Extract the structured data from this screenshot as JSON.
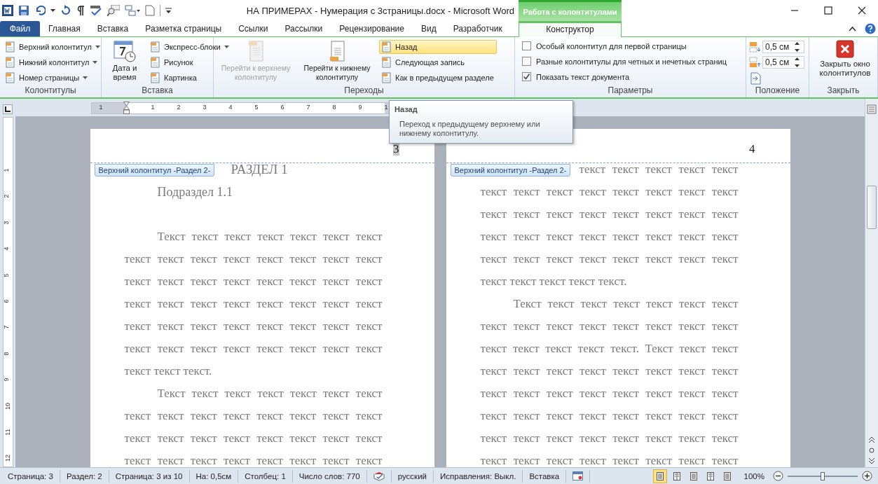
{
  "title_bar": {
    "title": "НА ПРИМЕРАХ - Нумерация с 3страницы.docx  -  Microsoft Word",
    "context_group": "Работа с колонтитулами"
  },
  "tabs": [
    {
      "label": "Файл",
      "kind": "file",
      "selected": false
    },
    {
      "label": "Главная",
      "kind": "tab",
      "selected": false
    },
    {
      "label": "Вставка",
      "kind": "tab",
      "selected": false
    },
    {
      "label": "Разметка страницы",
      "kind": "tab",
      "selected": false
    },
    {
      "label": "Ссылки",
      "kind": "tab",
      "selected": false
    },
    {
      "label": "Рассылки",
      "kind": "tab",
      "selected": false
    },
    {
      "label": "Рецензирование",
      "kind": "tab",
      "selected": false
    },
    {
      "label": "Вид",
      "kind": "tab",
      "selected": false
    },
    {
      "label": "Разработчик",
      "kind": "tab",
      "selected": false
    },
    {
      "label": "Конструктор",
      "kind": "context",
      "selected": true
    }
  ],
  "ribbon": {
    "groups": [
      {
        "label": "Колонтитулы",
        "items": [
          {
            "kind": "small",
            "label": "Верхний колонтитул",
            "dropdown": true,
            "highlighted": false
          },
          {
            "kind": "small",
            "label": "Нижний колонтитул",
            "dropdown": true,
            "highlighted": false
          },
          {
            "kind": "small",
            "label": "Номер страницы",
            "dropdown": true,
            "highlighted": false
          }
        ]
      },
      {
        "label": "Вставка",
        "items": [
          {
            "kind": "large",
            "label": "Дата и время",
            "disabled": false
          },
          {
            "kind": "small",
            "label": "Экспресс-блоки",
            "dropdown": true,
            "highlighted": false
          },
          {
            "kind": "small",
            "label": "Рисунок",
            "dropdown": false,
            "highlighted": false
          },
          {
            "kind": "small",
            "label": "Картинка",
            "dropdown": false,
            "highlighted": false
          }
        ]
      },
      {
        "label": "Переходы",
        "items": [
          {
            "kind": "large",
            "label": "Перейти к верхнему колонтитулу",
            "disabled": true
          },
          {
            "kind": "large",
            "label": "Перейти к нижнему колонтитулу",
            "disabled": false
          },
          {
            "kind": "small",
            "label": "Назад",
            "dropdown": false,
            "highlighted": true
          },
          {
            "kind": "small",
            "label": "Следующая запись",
            "dropdown": false,
            "highlighted": false
          },
          {
            "kind": "small",
            "label": "Как в предыдущем разделе",
            "dropdown": false,
            "highlighted": false
          }
        ]
      },
      {
        "label": "Параметры",
        "items": [
          {
            "kind": "checkbox",
            "label": "Особый колонтитул для первой страницы",
            "checked": false
          },
          {
            "kind": "checkbox",
            "label": "Разные колонтитулы для четных и нечетных страниц",
            "checked": false
          },
          {
            "kind": "checkbox",
            "label": "Показать текст документа",
            "checked": true
          }
        ]
      },
      {
        "label": "Положение",
        "items": [
          {
            "kind": "spinner",
            "value": "0,5 см"
          },
          {
            "kind": "spinner",
            "value": "0,5 см"
          },
          {
            "kind": "icon"
          }
        ]
      },
      {
        "label": "Закрыть",
        "items": [
          {
            "kind": "large",
            "label": "Закрыть окно колонтитулов",
            "disabled": false
          }
        ]
      }
    ]
  },
  "ruler": {
    "numbers": [
      "1",
      "1",
      "2",
      "3",
      "4",
      "5",
      "6",
      "7",
      "8",
      "9",
      "1"
    ],
    "vertical_numbers": [
      "1",
      "2",
      "3",
      "4",
      "5",
      "6",
      "7",
      "8",
      "9",
      "10",
      "11",
      "12"
    ]
  },
  "tooltip": {
    "title": "Назад",
    "text": "Переход к предыдущему верхнему или нижнему колонтитулу."
  },
  "pages": [
    {
      "number": "3",
      "number_selected": true,
      "header_label": "Верхний колонтитул -Раздел 2-",
      "lines": [
        {
          "kind": "heading",
          "text": "РАЗДЕЛ 1"
        },
        {
          "kind": "subheading",
          "text": "Подраздел 1.1"
        },
        {
          "kind": "first",
          "text": "Текст текст текст текст текст текст текст"
        },
        {
          "kind": "full",
          "text": "текст текст текст текст текст текст текст текст"
        },
        {
          "kind": "full",
          "text": "текст текст текст текст текст текст текст текст"
        },
        {
          "kind": "full",
          "text": "текст текст текст текст текст текст текст текст"
        },
        {
          "kind": "full",
          "text": "текст текст текст текст текст текст текст текст"
        },
        {
          "kind": "full",
          "text": "текст текст текст текст текст текст текст текст"
        },
        {
          "kind": "last",
          "text": "текст текст текст."
        },
        {
          "kind": "first",
          "text": "Текст текст текст текст текст текст текст"
        },
        {
          "kind": "full",
          "text": "текст текст текст текст текст текст текст текст"
        },
        {
          "kind": "full",
          "text": "текст текст текст текст текст текст текст текст"
        },
        {
          "kind": "full",
          "text": "текст текст текст текст текст текст текст текст"
        }
      ]
    },
    {
      "number": "4",
      "number_selected": false,
      "header_label": "Верхний колонтитул -Раздел 2-",
      "lines": [
        {
          "kind": "continued",
          "text": "текст текст текст текст текст"
        },
        {
          "kind": "full",
          "text": "текст текст текст текст текст текст текст текст"
        },
        {
          "kind": "full",
          "text": "текст текст текст текст текст текст текст текст"
        },
        {
          "kind": "full",
          "text": "текст текст текст текст текст текст текст текст"
        },
        {
          "kind": "full",
          "text": "текст текст текст текст текст текст текст текст"
        },
        {
          "kind": "last",
          "text": "текст текст текст текст текст."
        },
        {
          "kind": "first",
          "text": "Текст текст текст текст текст текст текст"
        },
        {
          "kind": "full",
          "text": "текст текст текст текст текст текст текст текст"
        },
        {
          "kind": "full",
          "text": "текст текст текст текст текст. Текст текст текст"
        },
        {
          "kind": "full",
          "text": "текст текст текст текст текст текст текст текст"
        },
        {
          "kind": "full",
          "text": "текст текст текст текст текст текст текст текст"
        },
        {
          "kind": "full",
          "text": "текст текст текст текст текст текст текст текст"
        },
        {
          "kind": "full",
          "text": "текст текст текст текст текст текст текст текст"
        },
        {
          "kind": "full",
          "text": "текст текст текст текст текст текст текст текст"
        }
      ]
    }
  ],
  "status_bar": {
    "items": [
      {
        "kind": "text",
        "text": "Страница: 3"
      },
      {
        "kind": "text",
        "text": "Раздел: 2"
      },
      {
        "kind": "text",
        "text": "Страница: 3 из 10"
      },
      {
        "kind": "text",
        "text": "На: 0,5см"
      },
      {
        "kind": "text",
        "text": "Столбец: 1"
      },
      {
        "kind": "text",
        "text": "Число слов: 770"
      },
      {
        "kind": "proofing"
      },
      {
        "kind": "text",
        "text": "русский"
      },
      {
        "kind": "text",
        "text": "Исправления: Выкл."
      },
      {
        "kind": "text",
        "text": "Вставка"
      },
      {
        "kind": "macro"
      }
    ],
    "views": [
      {
        "selected": true
      },
      {
        "selected": false
      },
      {
        "selected": false
      },
      {
        "selected": false
      },
      {
        "selected": false
      }
    ],
    "zoom": {
      "label": "100%",
      "level": 0.5
    }
  }
}
